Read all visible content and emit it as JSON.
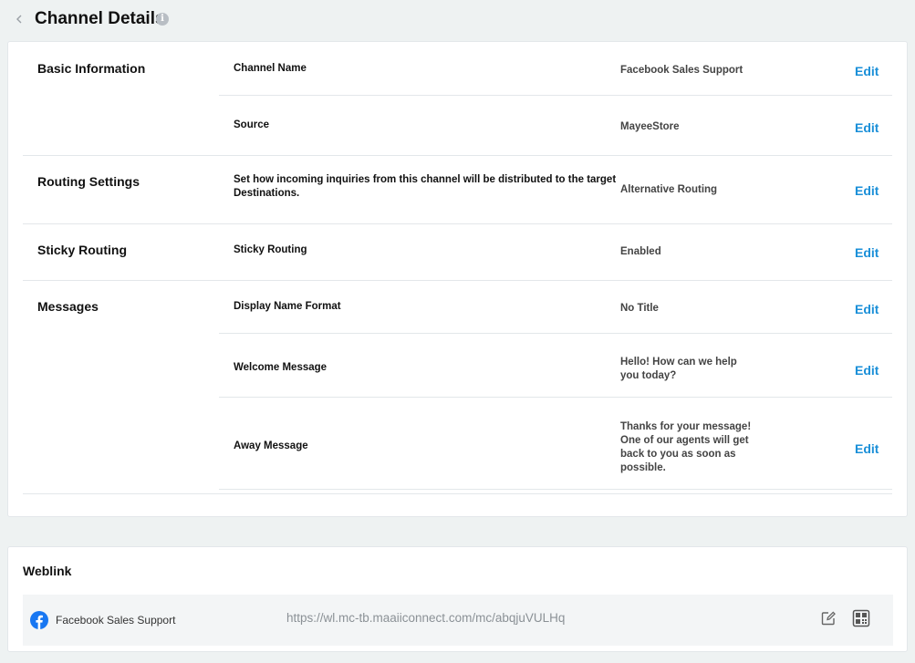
{
  "header": {
    "title": "Channel Details",
    "info_symbol": "i"
  },
  "sections": {
    "basic": {
      "title": "Basic Information",
      "rows": [
        {
          "label": "Channel Name",
          "value": "Facebook Sales Support",
          "action": "Edit"
        },
        {
          "label": "Source",
          "value": "MayeeStore",
          "action": "Edit"
        }
      ]
    },
    "routing": {
      "title": "Routing Settings",
      "rows": [
        {
          "label": "Set how incoming inquiries from this channel will be distributed to the target Destinations.",
          "value": "Alternative Routing",
          "action": "Edit"
        }
      ]
    },
    "sticky": {
      "title": "Sticky Routing",
      "rows": [
        {
          "label": "Sticky Routing",
          "value": "Enabled",
          "action": "Edit"
        }
      ]
    },
    "messages": {
      "title": "Messages",
      "rows": [
        {
          "label": "Display Name Format",
          "value": "No Title",
          "action": "Edit"
        },
        {
          "label": "Welcome Message",
          "value": "Hello! How can we help you today?",
          "action": "Edit"
        },
        {
          "label": "Away Message",
          "value": "Thanks for your message! One of our agents will get back to you as soon as possible.",
          "action": "Edit"
        }
      ]
    }
  },
  "weblink": {
    "title": "Weblink",
    "name": "Facebook Sales Support",
    "url": "https://wl.mc-tb.maaiiconnect.com/mc/abqjuVULHq",
    "icons": [
      "facebook-icon",
      "edit-icon",
      "qr-code-icon"
    ]
  },
  "colors": {
    "accent": "#1a8fd8",
    "background": "#eef2f2",
    "facebook": "#1877f2"
  }
}
